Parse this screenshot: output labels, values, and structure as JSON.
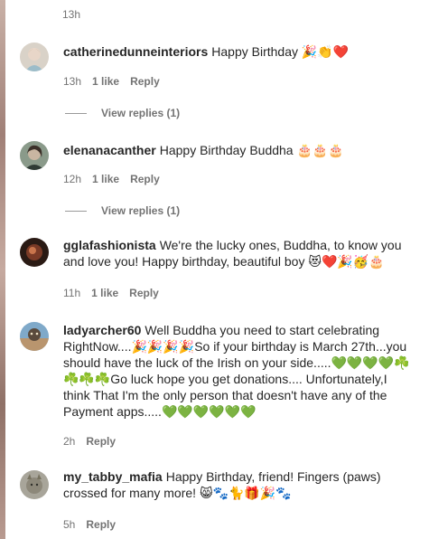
{
  "top_timestamp": "13h",
  "comments": [
    {
      "username": "catherinedunneinteriors",
      "text": "Happy Birthday 🎉👏❤️",
      "time": "13h",
      "likes": "1 like",
      "reply": "Reply",
      "view_replies": "View replies (1)"
    },
    {
      "username": "elenanacanther",
      "text": "Happy Birthday Buddha 🎂🎂🎂",
      "time": "12h",
      "likes": "1 like",
      "reply": "Reply",
      "view_replies": "View replies (1)"
    },
    {
      "username": "gglafashionista",
      "text": "We're the lucky ones, Buddha, to know you and love you! Happy birthday, beautiful boy 😻❤️🎉🥳🎂",
      "time": "11h",
      "likes": "1 like",
      "reply": "Reply"
    },
    {
      "username": "ladyarcher60",
      "text": "Well Buddha you need to start celebrating RightNow....🎉🎉🎉🎉So if your birthday is March 27th...you should have the luck of the Irish on your side.....💚💚💚💚☘️☘️☘️☘️Go luck hope you get donations.... Unfortunately,I think That I'm the only person that doesn't have any of the Payment apps.....💚💚💚💚💚💚",
      "time": "2h",
      "reply": "Reply"
    },
    {
      "username": "my_tabby_mafia",
      "text": "Happy Birthday, friend! Fingers (paws) crossed for many more! 😸🐾🐈🎁🎉🐾",
      "time": "5h",
      "reply": "Reply"
    }
  ],
  "colors": {
    "text": "#262626",
    "secondary": "#737373",
    "background": "#ffffff"
  }
}
